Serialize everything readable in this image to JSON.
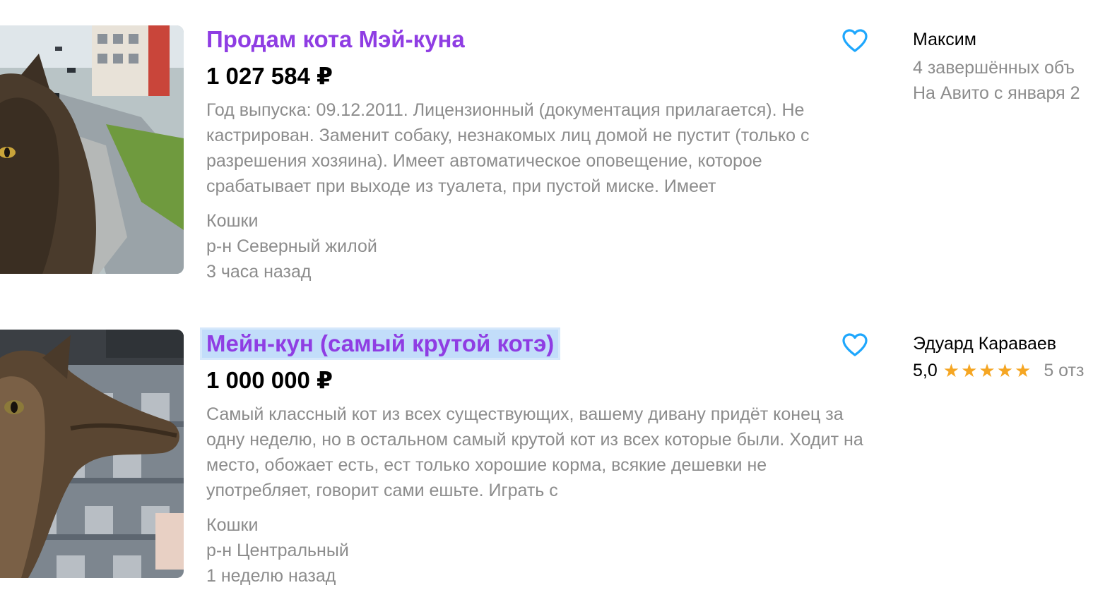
{
  "listings": [
    {
      "title": "Продам кота Мэй-куна",
      "price": "1 027 584 ₽",
      "description": "Год выпуска: 09.12.2011. Лицензионный (документация прилагается). Не кастрирован. Заменит собаку, незнакомых лиц домой не пустит (только с разрешения хозяина). Имеет автоматическое оповещение, которое срабатывает при выходе из туалета, при пустой миске. Имеет",
      "category": "Кошки",
      "location": "р-н Северный жилой",
      "time": "3 часа назад",
      "seller": {
        "name": "Максим",
        "line1": "4 завершённых объ",
        "line2": "На Авито с января 2"
      }
    },
    {
      "title": "Мейн-кун (самый крутой котэ)",
      "price": "1 000 000 ₽",
      "description": "Самый классный кот из всех существующих, вашему дивану придёт конец за одну неделю, но в остальном самый крутой кот из всех которые были. Ходит на место, обожает есть, ест только хорошие корма, всякие дешевки не употребляет, говорит сами ешьте. Играть с",
      "category": "Кошки",
      "location": "р-н Центральный",
      "time": "1 неделю назад",
      "seller": {
        "name": "Эдуард Караваев",
        "rating": "5,0",
        "stars": "★★★★★",
        "reviews": "5 отз"
      }
    }
  ],
  "icons": {
    "favorite": "heart-icon"
  },
  "colors": {
    "title": "#8f3de3",
    "heart": "#1ea7fd",
    "star": "#f5a623",
    "secondary": "#8c8c8c"
  }
}
